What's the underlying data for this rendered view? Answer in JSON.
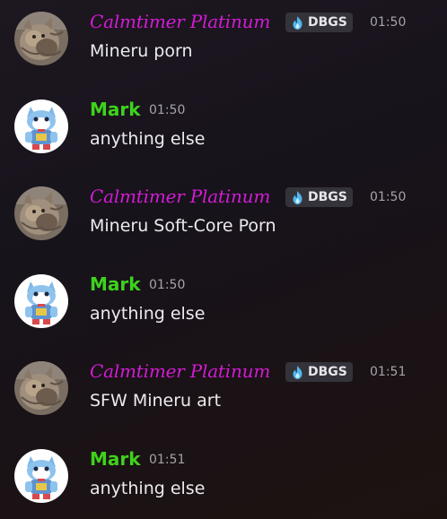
{
  "messages": [
    {
      "author": "Calmtimer Platinum",
      "tag": "DBGS",
      "time": "01:50",
      "text": "Mineru porn"
    },
    {
      "author": "Mark",
      "time": "01:50",
      "text": "anything else"
    },
    {
      "author": "Calmtimer Platinum",
      "tag": "DBGS",
      "time": "01:50",
      "text": "Mineru Soft-Core Porn"
    },
    {
      "author": "Mark",
      "time": "01:50",
      "text": "anything else"
    },
    {
      "author": "Calmtimer Platinum",
      "tag": "DBGS",
      "time": "01:51",
      "text": "SFW Mineru art"
    },
    {
      "author": "Mark",
      "time": "01:51",
      "text": "anything else"
    }
  ],
  "colors": {
    "calmtimer_name": "#d41bd6",
    "mark_name": "#3ed21c",
    "tag_bg": "#35333a",
    "tag_icon": "#4fb8ee"
  },
  "icons": {
    "tag": "flame-icon",
    "calmtimer_avatar": "cat-avatar",
    "mark_avatar": "robot-cat-avatar"
  }
}
